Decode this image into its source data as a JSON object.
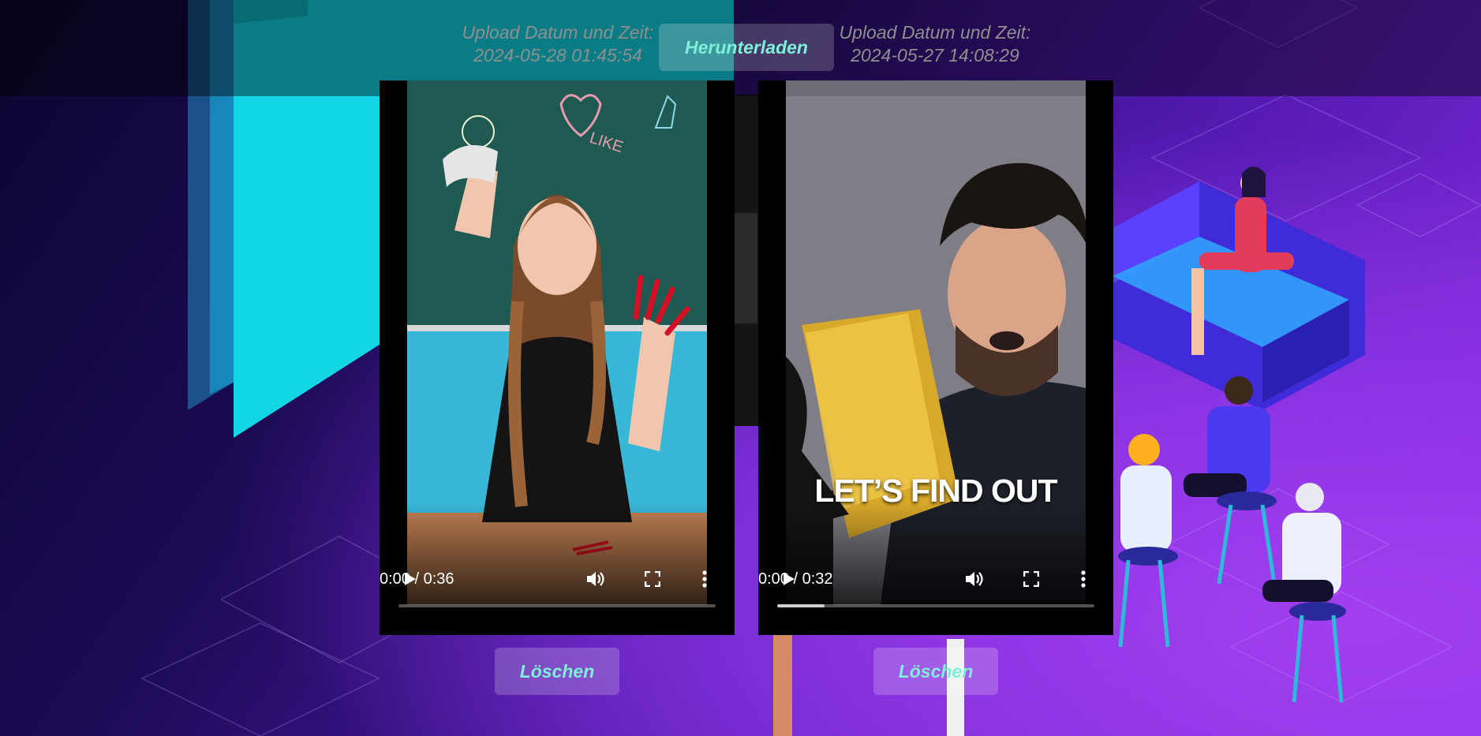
{
  "header": {
    "download_label": "Herunterladen"
  },
  "videos": [
    {
      "upload_label": "Upload Datum und Zeit:",
      "upload_datetime": "2024-05-28 01:45:54",
      "time_display": "0:00 / 0:36",
      "progress": 0.0,
      "delete_label": "Löschen"
    },
    {
      "upload_label": "Upload Datum und Zeit:",
      "upload_datetime": "2024-05-27 14:08:29",
      "time_display": "0:00 / 0:32",
      "progress": 0.15,
      "caption": "LET’S FIND OUT",
      "delete_label": "Löschen"
    }
  ],
  "icons": {
    "play": "play-icon",
    "volume": "volume-icon",
    "fullscreen": "fullscreen-icon",
    "more": "more-vertical-icon"
  },
  "colors": {
    "button_text": "#7df0d7",
    "button_bg": "rgba(255,255,255,0.20)",
    "info_text": "#8f8f8f",
    "teal": "#12d6e6",
    "purple": "#8a2be6"
  }
}
